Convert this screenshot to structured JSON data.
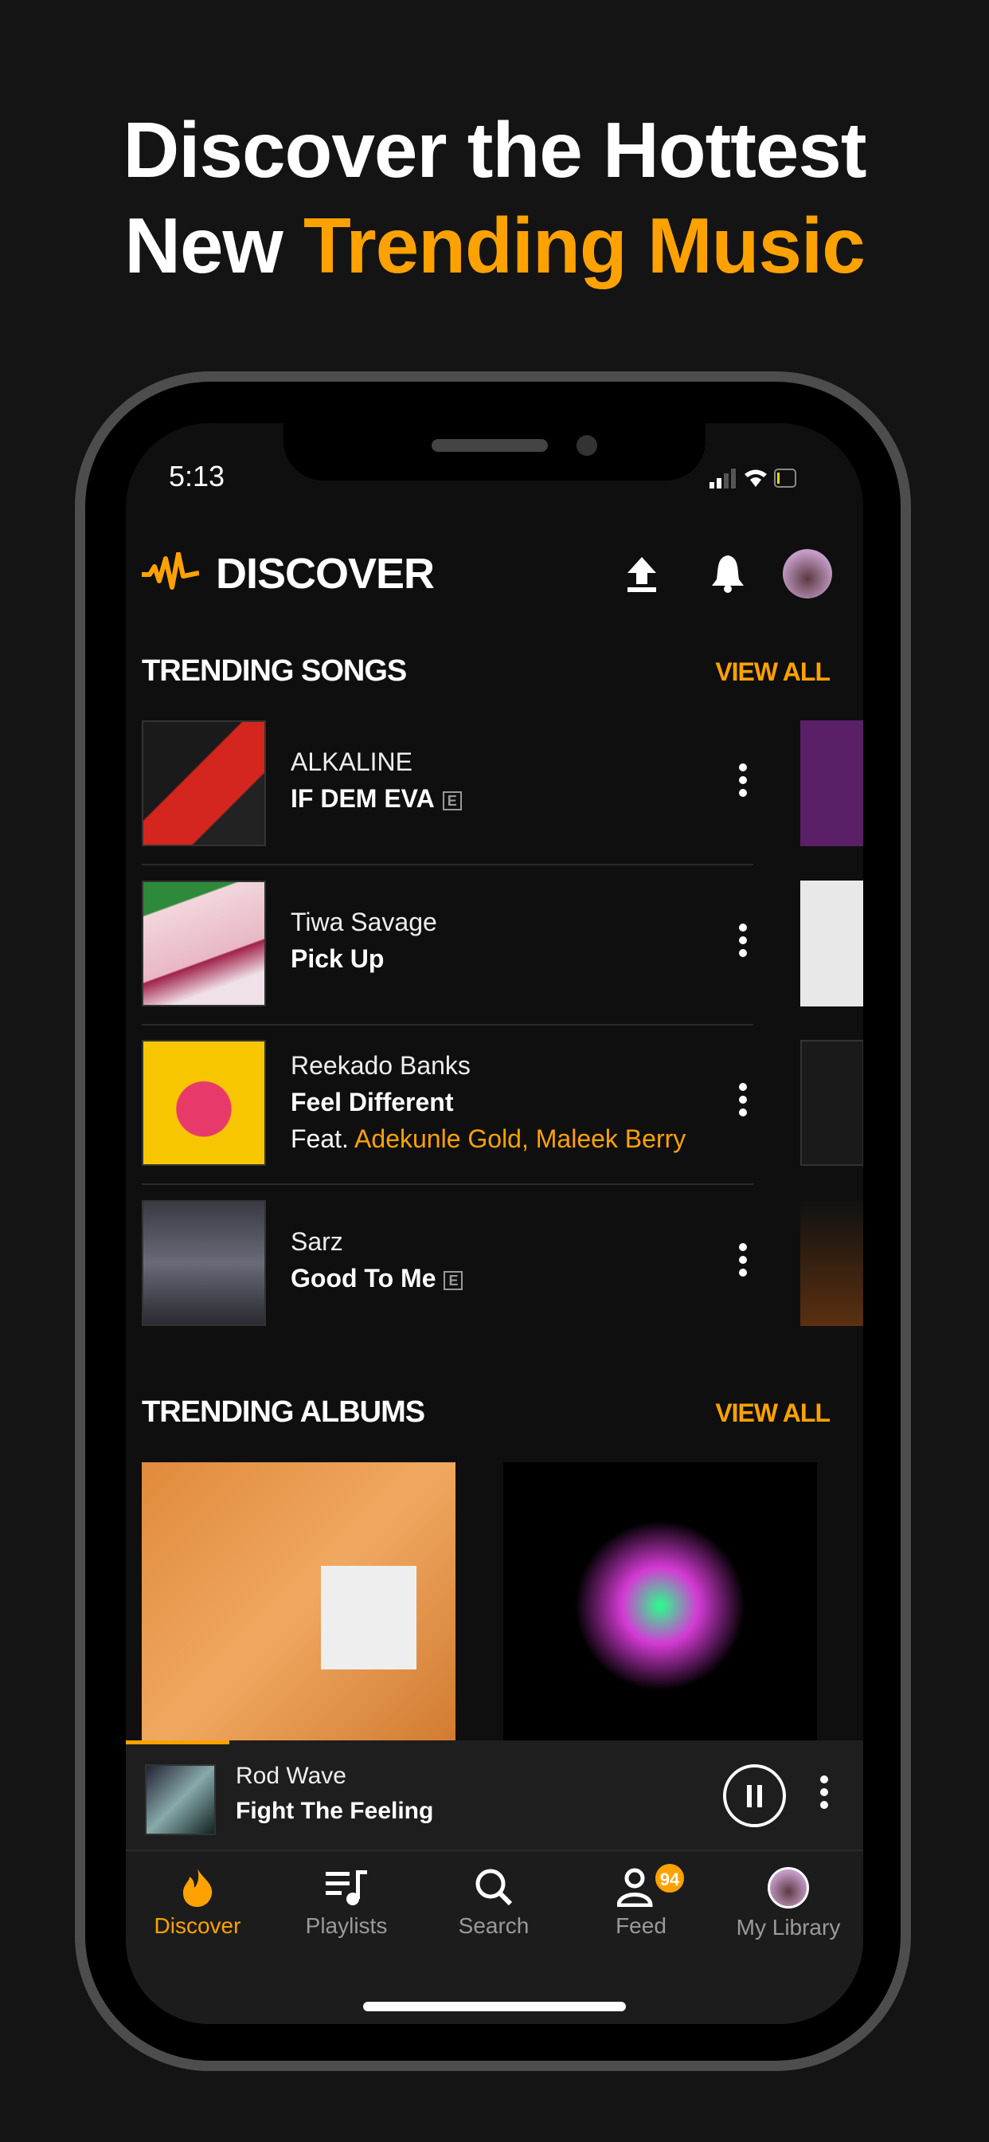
{
  "headline": {
    "line1": "Discover the Hottest",
    "line2_prefix": "New ",
    "line2_accent": "Trending Music"
  },
  "status_bar": {
    "time": "5:13"
  },
  "header": {
    "title": "DISCOVER"
  },
  "trending_songs": {
    "title": "TRENDING SONGS",
    "view_all": "VIEW ALL",
    "items": [
      {
        "artist": "ALKALINE",
        "title": "IF DEM EVA",
        "explicit": "E"
      },
      {
        "artist": "Tiwa Savage",
        "title": "Pick Up"
      },
      {
        "artist": "Reekado Banks",
        "title": "Feel Different",
        "feat_label": "Feat. ",
        "feat": "Adekunle Gold, Maleek Berry"
      },
      {
        "artist": "Sarz",
        "title": "Good To Me",
        "explicit": "E"
      }
    ]
  },
  "trending_albums": {
    "title": "TRENDING ALBUMS",
    "view_all": "VIEW ALL"
  },
  "now_playing": {
    "artist": "Rod Wave",
    "title": "Fight The Feeling",
    "progress": 0.14
  },
  "tabs": [
    {
      "label": "Discover",
      "active": true
    },
    {
      "label": "Playlists"
    },
    {
      "label": "Search"
    },
    {
      "label": "Feed",
      "badge": "94"
    },
    {
      "label": "My Library"
    }
  ],
  "colors": {
    "accent": "#ffa200",
    "background": "#0f0f0f"
  }
}
